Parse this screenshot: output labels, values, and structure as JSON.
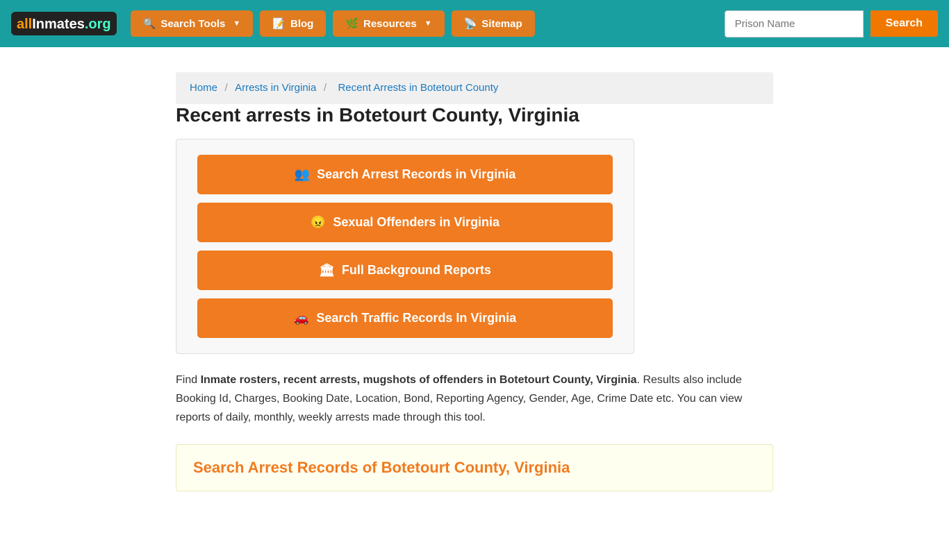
{
  "nav": {
    "logo_all": "all",
    "logo_inmates": "Inmates",
    "logo_org": ".org",
    "search_tools_label": "Search Tools",
    "blog_label": "Blog",
    "resources_label": "Resources",
    "sitemap_label": "Sitemap",
    "prison_name_placeholder": "Prison Name",
    "search_label": "Search"
  },
  "breadcrumb": {
    "home": "Home",
    "arrests_in_virginia": "Arrests in Virginia",
    "current": "Recent Arrests in Botetourt County"
  },
  "page": {
    "title": "Recent arrests in Botetourt County, Virginia"
  },
  "buttons": {
    "search_arrests": "Search Arrest Records in Virginia",
    "sexual_offenders": "Sexual Offenders in Virginia",
    "full_background": "Full Background Reports",
    "search_traffic": "Search Traffic Records In Virginia"
  },
  "description": {
    "intro": "Find ",
    "bold_part": "Inmate rosters, recent arrests, mugshots of offenders in Botetourt County, Virginia",
    "rest": ". Results also include Booking Id, Charges, Booking Date, Location, Bond, Reporting Agency, Gender, Age, Crime Date etc. You can view reports of daily, monthly, weekly arrests made through this tool."
  },
  "search_section": {
    "title": "Search Arrest Records of Botetourt County, Virginia"
  },
  "icons": {
    "search_tools": "🔍",
    "blog": "📝",
    "resources": "🌿",
    "sitemap": "📡",
    "arrest_search": "👥",
    "sex_offender": "😠",
    "background": "🏛",
    "traffic": "🚗"
  }
}
